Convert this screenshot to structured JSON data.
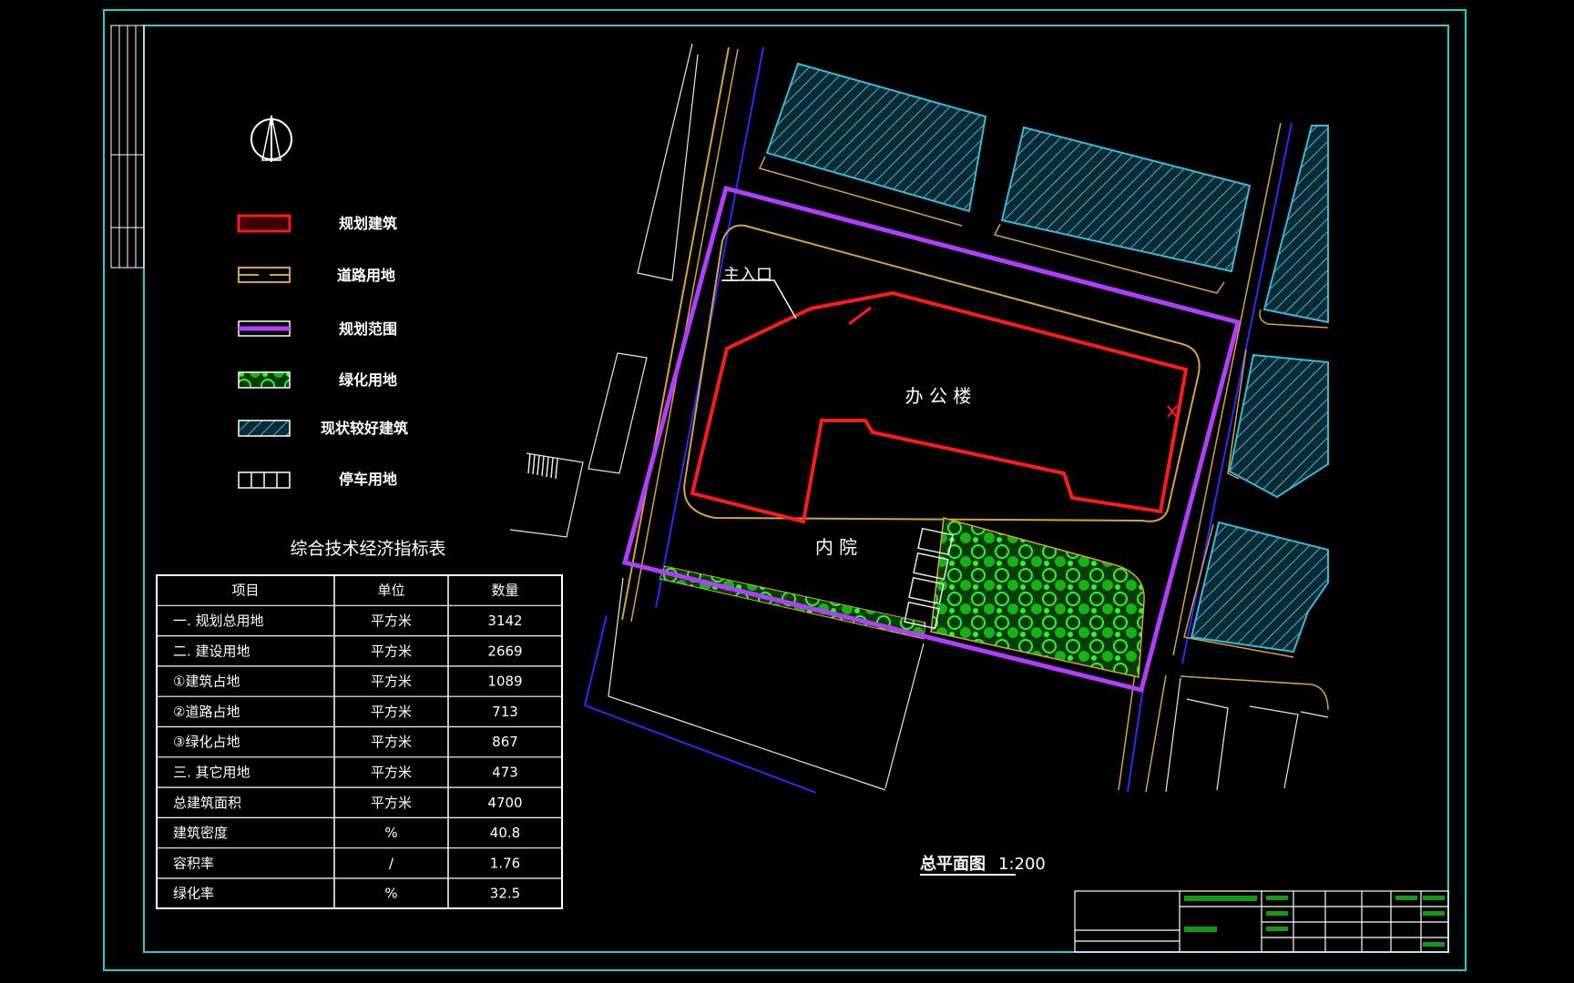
{
  "legend": [
    {
      "label": "规划建筑",
      "icon": "planned-building-swatch"
    },
    {
      "label": "道路用地",
      "icon": "road-land-swatch"
    },
    {
      "label": "规划范围",
      "icon": "planning-boundary-swatch"
    },
    {
      "label": "绿化用地",
      "icon": "green-land-swatch"
    },
    {
      "label": "现状较好建筑",
      "icon": "existing-building-swatch"
    },
    {
      "label": "停车用地",
      "icon": "parking-land-swatch"
    }
  ],
  "indicator_table": {
    "title": "综合技术经济指标表",
    "headers": [
      "项目",
      "单位",
      "数量"
    ],
    "rows": [
      [
        "一. 规划总用地",
        "平方米",
        "3142"
      ],
      [
        "二. 建设用地",
        "平方米",
        "2669"
      ],
      [
        "①建筑占地",
        "平方米",
        "1089"
      ],
      [
        "②道路占地",
        "平方米",
        "713"
      ],
      [
        "③绿化占地",
        "平方米",
        "867"
      ],
      [
        "三. 其它用地",
        "平方米",
        "473"
      ],
      [
        "总建筑面积",
        "平方米",
        "4700"
      ],
      [
        "建筑密度",
        "%",
        "40.8"
      ],
      [
        "容积率",
        "/",
        "1.76"
      ],
      [
        "绿化率",
        "%",
        "32.5"
      ]
    ]
  },
  "map": {
    "entrance_label": "主入口",
    "office_label": "办 公 楼",
    "courtyard_label": "内 院"
  },
  "drawing_title": "总平面图",
  "drawing_scale": "1:200",
  "colors": {
    "frame": "#1fd0c8",
    "planned_building": "#ff1a1a",
    "road": "#d8a43a",
    "boundary": "#b23cff",
    "green": "#22ff22",
    "existing_building": "#3ab8d8",
    "road_edge": "#2a2aff"
  }
}
